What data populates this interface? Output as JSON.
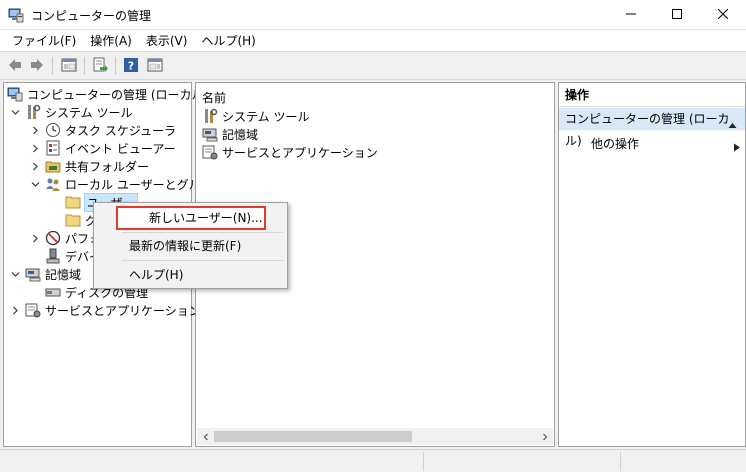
{
  "window": {
    "title": "コンピューターの管理",
    "icon": "computer-management-icon",
    "minimize_icon": "minimize-icon",
    "maximize_icon": "maximize-icon",
    "close_icon": "close-icon"
  },
  "menubar": {
    "items": [
      {
        "label": "ファイル(F)"
      },
      {
        "label": "操作(A)"
      },
      {
        "label": "表示(V)"
      },
      {
        "label": "ヘルプ(H)"
      }
    ]
  },
  "toolbar": {
    "buttons": [
      "back-arrow-icon",
      "forward-arrow-icon",
      "show-hide-console-tree-icon",
      "export-list-icon",
      "help-icon",
      "show-hide-action-pane-icon"
    ]
  },
  "tree": {
    "root": "コンピューターの管理 (ローカル)",
    "system_tools": "システム ツール",
    "task_scheduler": "タスク スケジューラ",
    "event_viewer": "イベント ビューアー",
    "shared_folders": "共有フォルダー",
    "local_users_groups": "ローカル ユーザーとグループ",
    "users": "ユーザー",
    "groups": "グ",
    "performance": "パフォ",
    "device_manager": "デバイ",
    "storage": "記憶域",
    "disk_management": "ディスクの管理",
    "services_apps": "サービスとアプリケーション"
  },
  "list": {
    "column_name": "名前",
    "rows": [
      {
        "label": "システム ツール",
        "icon": "system-tools-icon"
      },
      {
        "label": "記憶域",
        "icon": "storage-icon"
      },
      {
        "label": "サービスとアプリケーション",
        "icon": "services-apps-icon"
      }
    ]
  },
  "actions": {
    "header": "操作",
    "group": "コンピューターの管理 (ローカル)",
    "more": "他の操作"
  },
  "context_menu": {
    "new_user": "新しいユーザー(N)...",
    "refresh": "最新の情報に更新(F)",
    "help": "ヘルプ(H)"
  },
  "colors": {
    "selection": "#cce8ff",
    "action_group": "#d9e8f7",
    "highlight_border": "#e03c2d"
  }
}
